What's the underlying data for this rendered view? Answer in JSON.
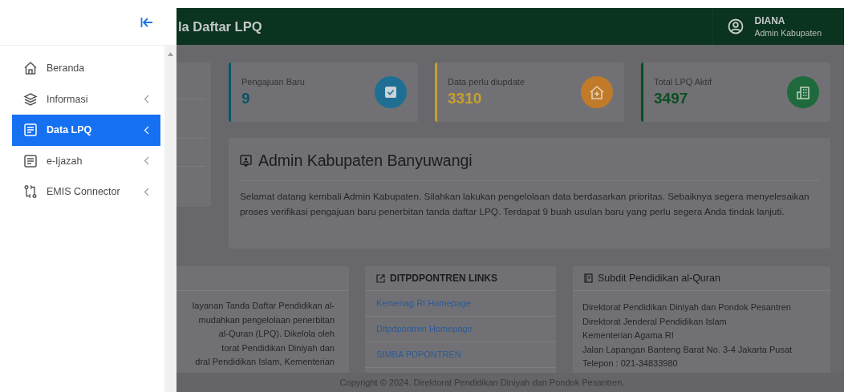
{
  "sidebar": {
    "items": [
      {
        "label": "Beranda",
        "kind": "home",
        "selected": false,
        "has_submenu": false
      },
      {
        "label": "Informasi",
        "kind": "layers",
        "selected": false,
        "has_submenu": true
      },
      {
        "label": "Data LPQ",
        "kind": "document",
        "selected": true,
        "has_submenu": true
      },
      {
        "label": "e-Ijazah",
        "kind": "document",
        "selected": false,
        "has_submenu": true
      },
      {
        "label": "EMIS Connector",
        "kind": "connector",
        "selected": false,
        "has_submenu": true
      }
    ]
  },
  "header": {
    "title": "la Daftar LPQ",
    "user_name": "DIANA",
    "user_role": "Admin Kabupaten"
  },
  "stats": [
    {
      "label": "Pengajuan Baru",
      "value": "9",
      "color": "#0a5563",
      "kind": "check"
    },
    {
      "label": "Data perlu diupdate",
      "value": "3310",
      "color": "#c8a030",
      "kind": "house"
    },
    {
      "label": "Total LPQ Aktif",
      "value": "3497",
      "color": "#0b4f20",
      "kind": "building"
    }
  ],
  "welcome": {
    "title": "Admin Kabupaten Banyuwangi",
    "text": "Selamat datang kembali Admin Kabupaten. Silahkan lakukan pengelolaan data berdasarkan prioritas. Sebaiknya segera menyelesaikan proses verifikasi pengajuan baru penerbitan tanda daftar LPQ. Terdapat 9 buah usulan baru yang perlu segera Anda tindak lanjuti."
  },
  "about_card": {
    "lines": [
      "layanan Tanda Daftar Pendidikan al-",
      "mudahkan pengelolaan penerbitan",
      "al-Quran (LPQ). Dikelola oleh",
      "torat Pendidikan Diniyah dan",
      "dral Pendidikan Islam, Kementerian"
    ]
  },
  "links_card": {
    "title": "DITPDPONTREN LINKS",
    "links": [
      "Kemenag RI Homepage",
      "Ditpdpontren Homepage",
      "SIMBA PDPONTREN"
    ]
  },
  "subdit_card": {
    "title": "Subdit Pendidikan al-Quran",
    "lines": [
      "Direktorat Pendidikan Diniyah dan Pondok Pesantren",
      "Direktorat Jenderal Pendidikan Islam",
      "Kementerian Agama RI",
      "Jalan Lapangan Banteng Barat No. 3-4 Jakarta Pusat",
      "Telepon : 021-34833980"
    ]
  },
  "footer": {
    "text": "Copyright © 2024. Direktorat Pendidikan Diniyah dan Pondok Pesantren."
  }
}
